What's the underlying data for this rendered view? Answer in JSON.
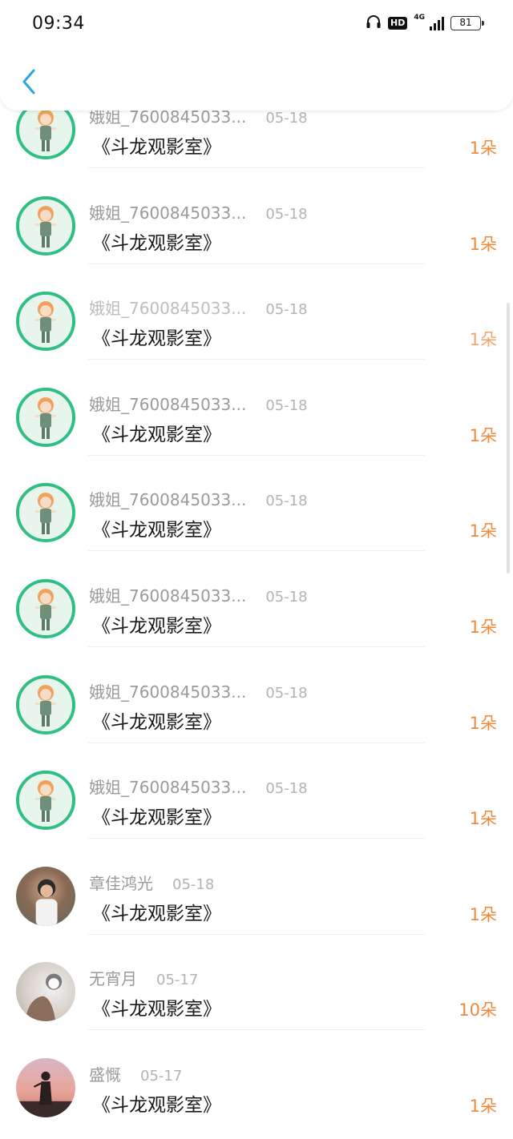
{
  "status_bar": {
    "time": "09:34",
    "hd_label": "HD",
    "network_label": "4G",
    "battery_level": "81"
  },
  "header": {
    "back_icon": "chevron-left-icon",
    "accent_color": "#2ea7e0"
  },
  "gift_records": [
    {
      "username": "娥姐_7600845033...",
      "date": "05-18",
      "gift": "《斗龙观影室》",
      "amount": "1朵",
      "avatar": "anime"
    },
    {
      "username": "娥姐_7600845033...",
      "date": "05-18",
      "gift": "《斗龙观影室》",
      "amount": "1朵",
      "avatar": "anime"
    },
    {
      "username": "娥姐_7600845033...",
      "date": "05-18",
      "gift": "《斗龙观影室》",
      "amount": "1朵",
      "avatar": "anime"
    },
    {
      "username": "娥姐_7600845033...",
      "date": "05-18",
      "gift": "《斗龙观影室》",
      "amount": "1朵",
      "avatar": "anime"
    },
    {
      "username": "娥姐_7600845033...",
      "date": "05-18",
      "gift": "《斗龙观影室》",
      "amount": "1朵",
      "avatar": "anime"
    },
    {
      "username": "娥姐_7600845033...",
      "date": "05-18",
      "gift": "《斗龙观影室》",
      "amount": "1朵",
      "avatar": "anime"
    },
    {
      "username": "娥姐_7600845033...",
      "date": "05-18",
      "gift": "《斗龙观影室》",
      "amount": "1朵",
      "avatar": "anime"
    },
    {
      "username": "娥姐_7600845033...",
      "date": "05-18",
      "gift": "《斗龙观影室》",
      "amount": "1朵",
      "avatar": "anime"
    },
    {
      "username": "章佳鸿光",
      "date": "05-18",
      "gift": "《斗龙观影室》",
      "amount": "1朵",
      "avatar": "photo1"
    },
    {
      "username": "无宵月",
      "date": "05-17",
      "gift": "《斗龙观影室》",
      "amount": "10朵",
      "avatar": "photo2"
    },
    {
      "username": "盛慨",
      "date": "05-17",
      "gift": "《斗龙观影室》",
      "amount": "1朵",
      "avatar": "photo3"
    }
  ],
  "colors": {
    "amount": "#ef8a3d",
    "avatar_ring": "#2fbf82",
    "back_arrow": "#2ea7e0"
  }
}
